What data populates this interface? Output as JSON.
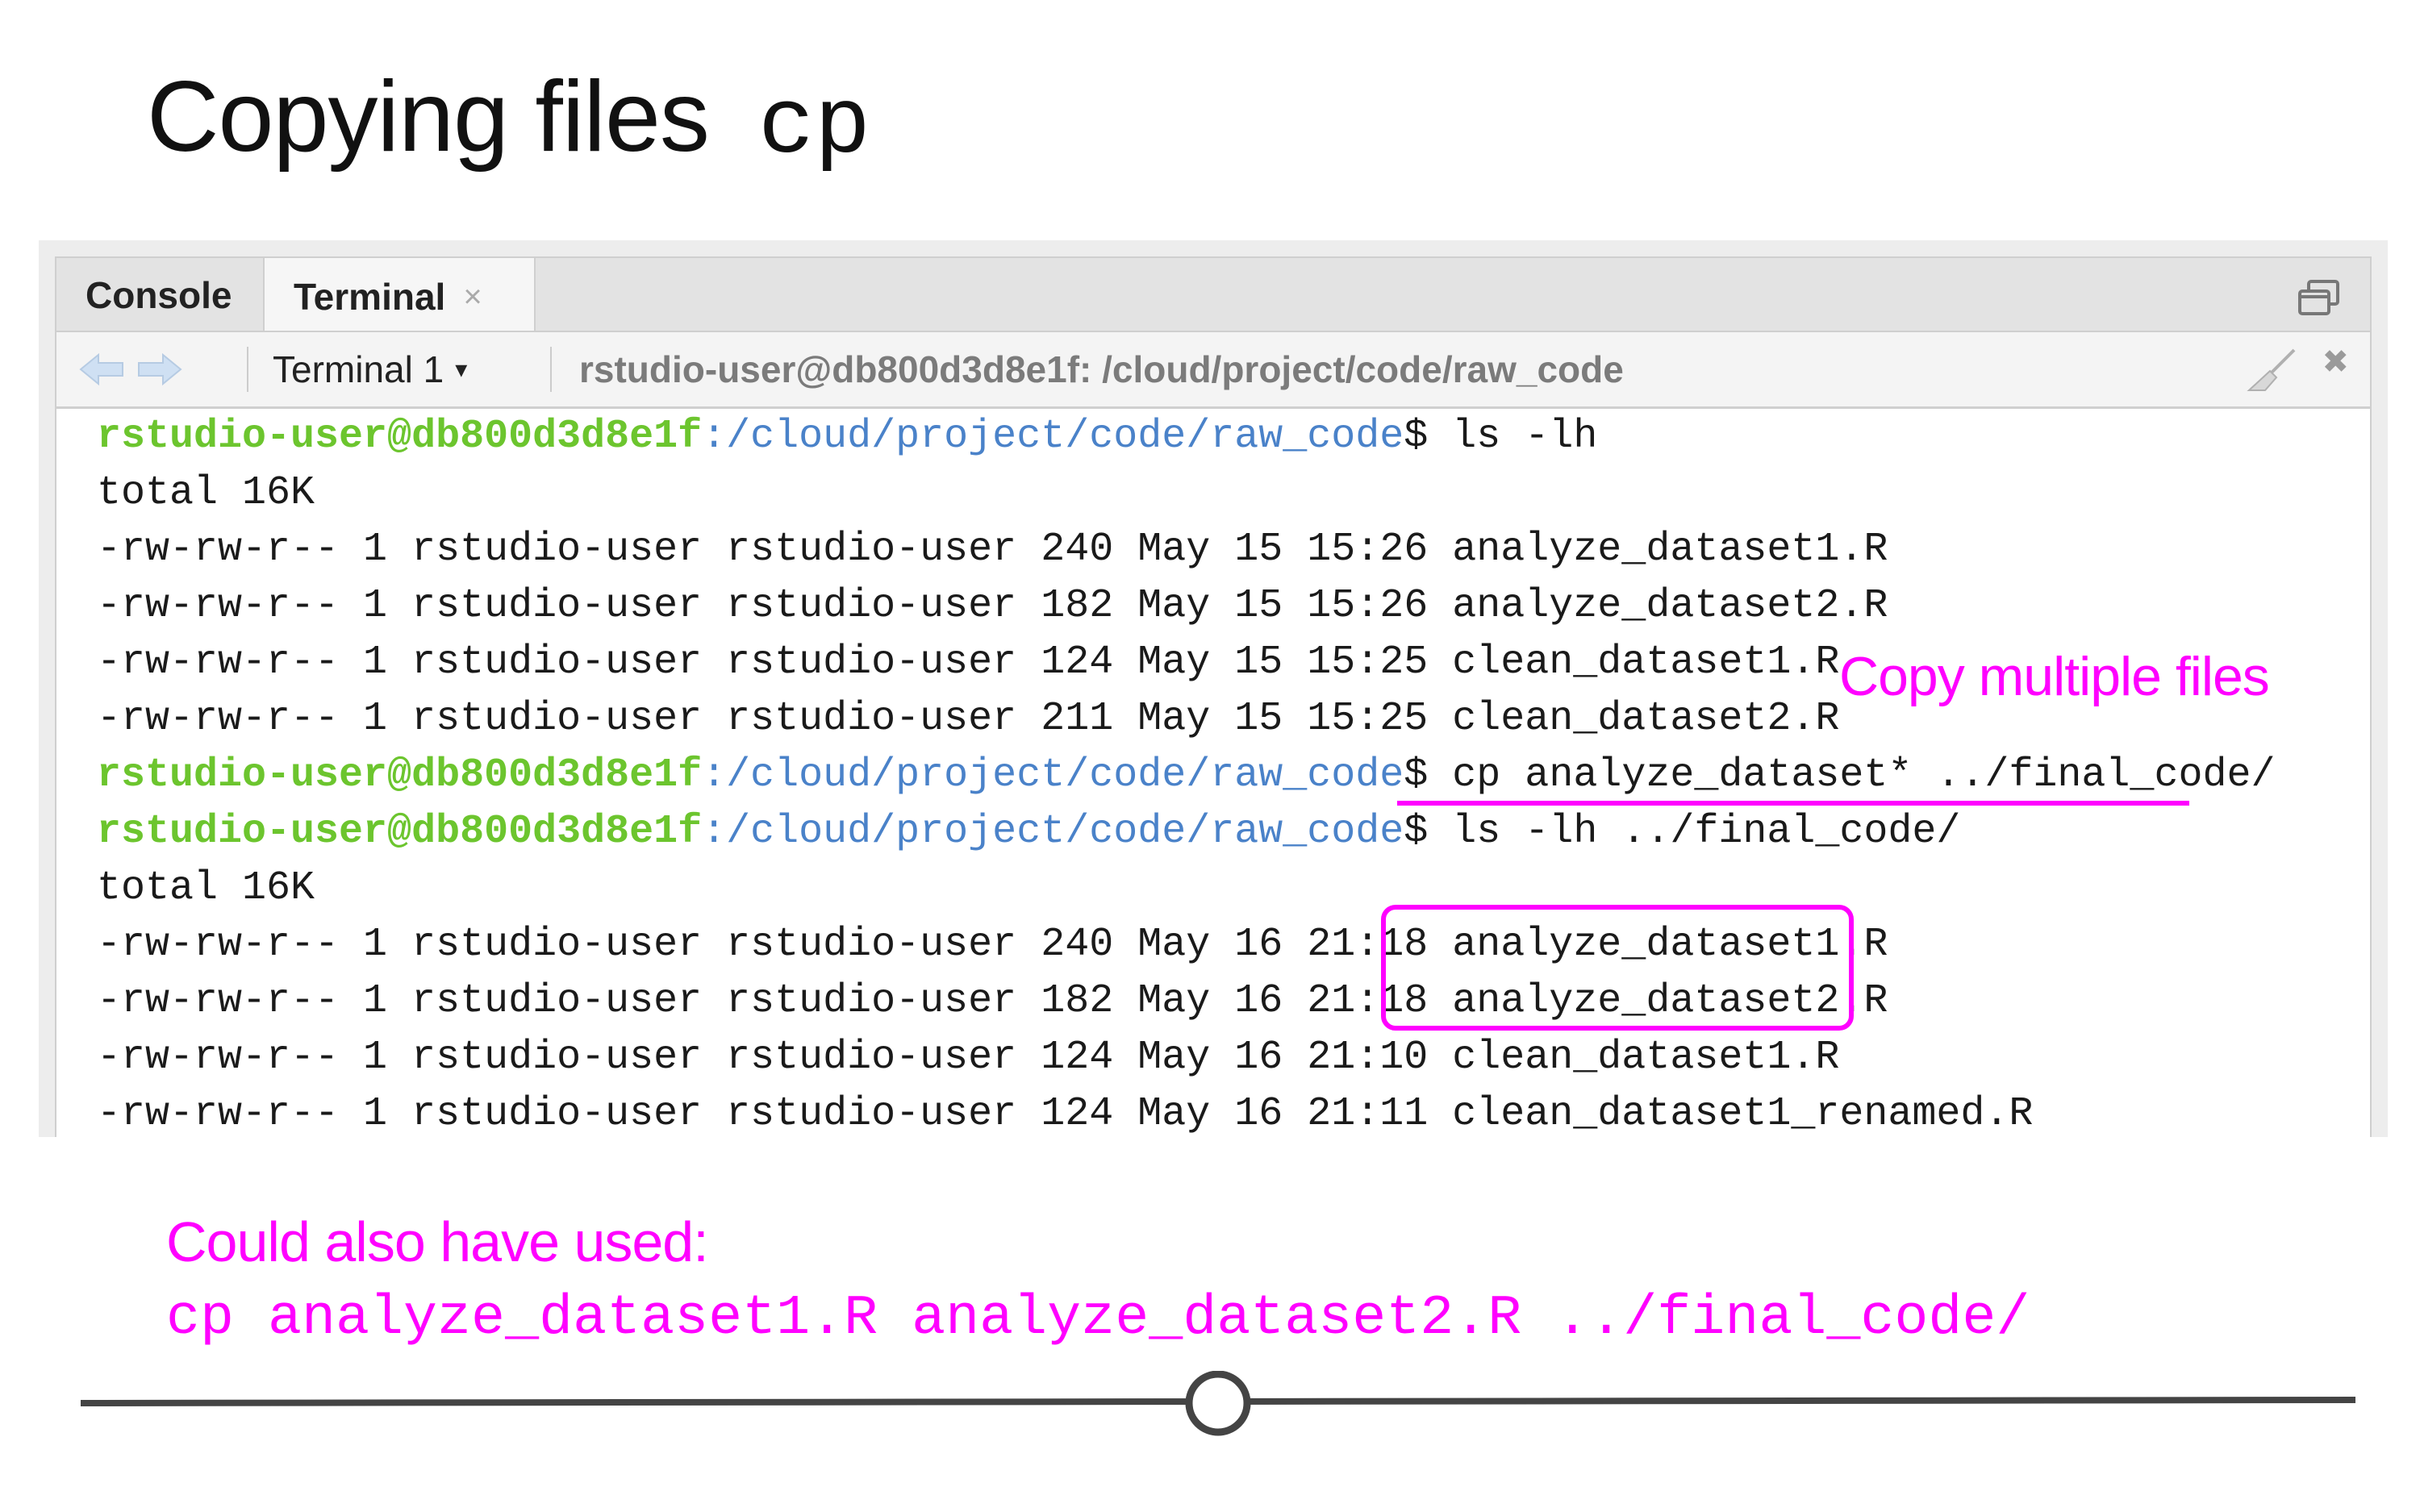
{
  "slide": {
    "title": "Copying files",
    "title_command": "cp"
  },
  "tabs": {
    "console": "Console",
    "terminal": "Terminal",
    "terminal_close": "×"
  },
  "toolbar": {
    "terminal_select": "Terminal 1",
    "caret": "▾",
    "path": "rstudio-user@db800d3d8e1f: /cloud/project/code/raw_code",
    "close": "✖"
  },
  "terminal": {
    "prompt_user": "rstudio-user@db800d3d8e1f",
    "prompt_path": ":/cloud/project/code/raw_code",
    "prompt_symbol": "$ ",
    "commands": [
      "ls -lh",
      "cp analyze_dataset* ../final_code/",
      "ls -lh ../final_code/"
    ],
    "total_line": "total 16K",
    "listing1": [
      "-rw-rw-r-- 1 rstudio-user rstudio-user 240 May 15 15:26 analyze_dataset1.R",
      "-rw-rw-r-- 1 rstudio-user rstudio-user 182 May 15 15:26 analyze_dataset2.R",
      "-rw-rw-r-- 1 rstudio-user rstudio-user 124 May 15 15:25 clean_dataset1.R",
      "-rw-rw-r-- 1 rstudio-user rstudio-user 211 May 15 15:25 clean_dataset2.R"
    ],
    "listing2": [
      "-rw-rw-r-- 1 rstudio-user rstudio-user 240 May 16 21:18 analyze_dataset1.R",
      "-rw-rw-r-- 1 rstudio-user rstudio-user 182 May 16 21:18 analyze_dataset2.R",
      "-rw-rw-r-- 1 rstudio-user rstudio-user 124 May 16 21:10 clean_dataset1.R",
      "-rw-rw-r-- 1 rstudio-user rstudio-user 124 May 16 21:11 clean_dataset1_renamed.R"
    ]
  },
  "annotations": {
    "callout": "Copy multiple files",
    "alt_label": "Could also have used:",
    "alt_command": "cp analyze_dataset1.R analyze_dataset2.R ../final_code/"
  },
  "progress": {
    "fraction": 0.5
  },
  "colors": {
    "accent": "#ff00ff",
    "prompt_user": "#6cc52e",
    "prompt_path": "#4a82c9"
  },
  "icons": [
    "back-arrow-icon",
    "forward-arrow-icon",
    "restore-window-icon",
    "clear-broom-icon",
    "close-icon"
  ]
}
